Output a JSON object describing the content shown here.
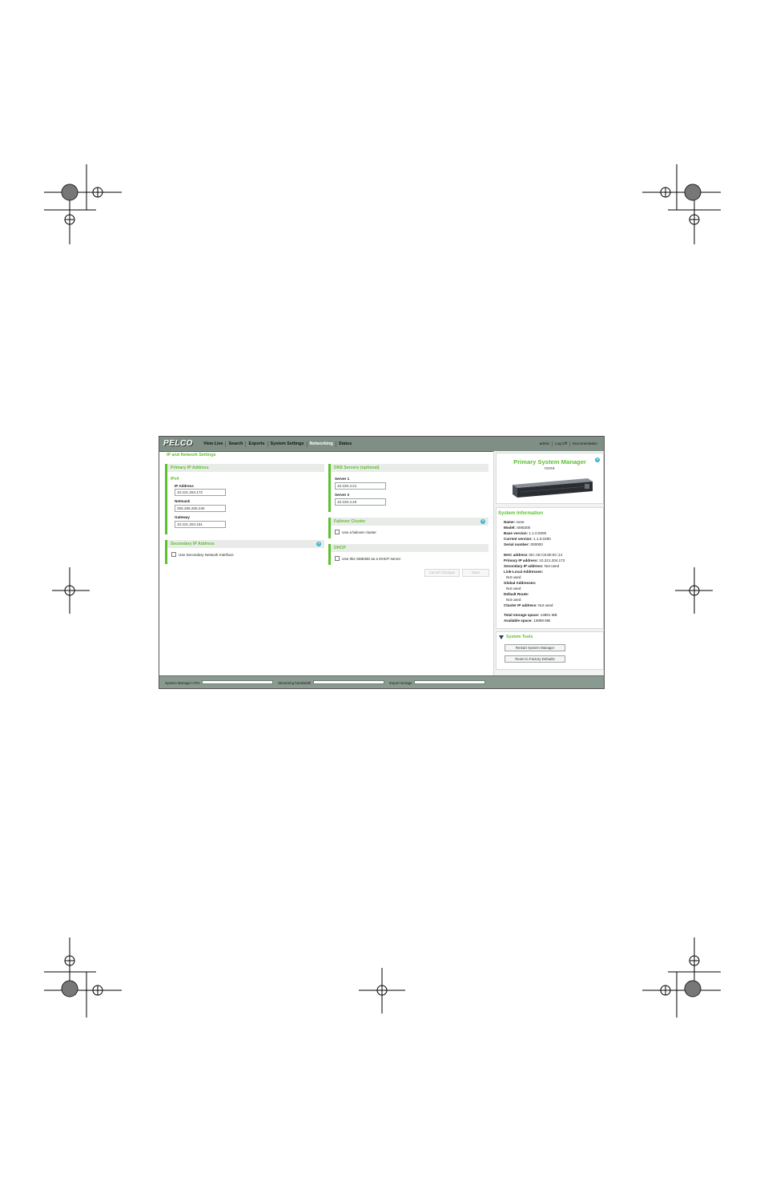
{
  "app": {
    "logo": "PELCO",
    "nav": [
      "View Live",
      "Search",
      "Exports",
      "System Settings",
      "Networking",
      "Status"
    ],
    "active_nav": "Networking",
    "right_nav": [
      "admin",
      "Log Off",
      "Documentation"
    ]
  },
  "page": {
    "title": "IP and Network Settings",
    "primary_ip": {
      "header": "Primary IP Address",
      "subheader": "IPv4",
      "ip_label": "IP Address",
      "ip_value": "10.221.204.172",
      "netmask_label": "Netmask",
      "netmask_value": "255.255.255.240",
      "gateway_label": "Gateway",
      "gateway_value": "10.221.204.161"
    },
    "secondary_ip": {
      "header": "Secondary IP Address",
      "checkbox_label": "Use Secondary Network Interface"
    },
    "dns": {
      "header": "DNS Servers (optional)",
      "server1_label": "Server 1",
      "server1_value": "10.220.4.21",
      "server2_label": "Server 2",
      "server2_value": "10.220.4.40"
    },
    "failover": {
      "header": "Failover Cluster",
      "checkbox_label": "Use a failover cluster"
    },
    "dhcp": {
      "header": "DHCP",
      "checkbox_label": "Use this SM5300 as a DHCP server"
    },
    "buttons": {
      "cancel": "Cancel Changes",
      "save": "Save"
    }
  },
  "sidebar": {
    "psm_title": "Primary System Manager",
    "psm_name": "none",
    "sysinfo_title": "System Information",
    "info": [
      {
        "k": "Name:",
        "v": "none"
      },
      {
        "k": "Model:",
        "v": "SM5300"
      },
      {
        "k": "Base version:",
        "v": "1.1.0.0000"
      },
      {
        "k": "Current version:",
        "v": "1.1.0.0290"
      },
      {
        "k": "Serial number:",
        "v": "000000"
      },
      {
        "k": "MAC address:",
        "v": "BC:AE:C5:80:0C:14"
      },
      {
        "k": "Primary IP address:",
        "v": "10.221.204.172"
      },
      {
        "k": "Secondary IP address:",
        "v": "Not used"
      },
      {
        "k": "Link-Local Addresses:",
        "v": ""
      },
      {
        "k": "",
        "v": "Not used"
      },
      {
        "k": "Global Addresses:",
        "v": ""
      },
      {
        "k": "",
        "v": "Not used"
      },
      {
        "k": "Default Route:",
        "v": ""
      },
      {
        "k": "",
        "v": "Not used"
      },
      {
        "k": "Cluster IP address:",
        "v": "Not used"
      },
      {
        "k": "Total storage space:",
        "v": "13891 MB"
      },
      {
        "k": "Available space:",
        "v": "13898 MB"
      }
    ],
    "tools_title": "System Tools",
    "tool_buttons": [
      "Restart System Manager",
      "Reset to Factory Defaults"
    ]
  },
  "statusbar": {
    "cpu_label": "System Manager CPU",
    "bandwidth_label": "Streaming bandwidth",
    "storage_label": "Export storage"
  }
}
